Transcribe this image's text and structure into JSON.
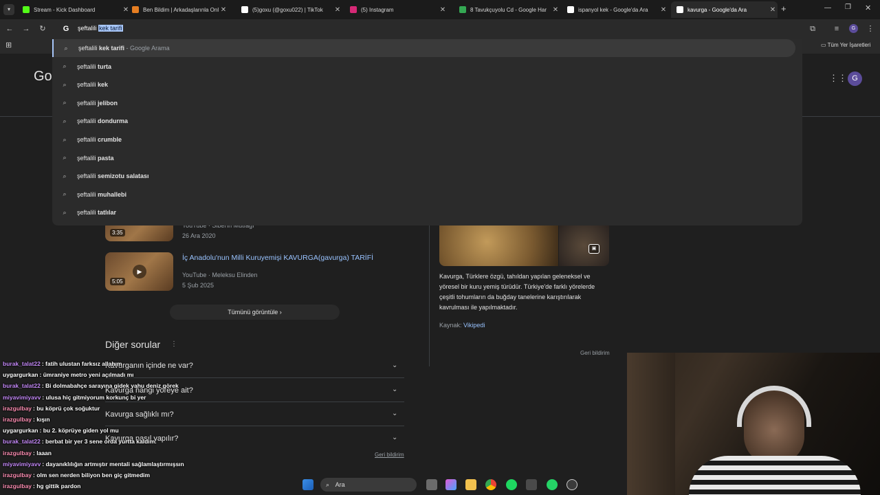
{
  "tabs": [
    {
      "title": "Stream - Kick Dashboard",
      "color": "#53fc18",
      "active": false
    },
    {
      "title": "Ben Bildim | Arkadaşlarınla Onl",
      "color": "#e67e22",
      "active": false
    },
    {
      "title": "(5)goxu (@goxu022) | TikTok",
      "color": "#ffffff",
      "active": false
    },
    {
      "title": "(5) Instagram",
      "color": "#d62976",
      "active": false
    },
    {
      "title": "8 Tavukçuyolu Cd - Google Har",
      "color": "#34a853",
      "active": false
    },
    {
      "title": "ispanyol kek - Google'da Ara",
      "color": "#ffffff",
      "active": false
    },
    {
      "title": "kavurga - Google'da Ara",
      "color": "#ffffff",
      "active": true
    }
  ],
  "omnibox": {
    "typed": "şeftalili ",
    "selected": "kek tarifi"
  },
  "bookmarks": {
    "all_label": "Tüm Yer İşaretleri"
  },
  "suggestions": [
    {
      "prefix": "şeftalili ",
      "bold": "kek tarifi",
      "suffix": " - Google Arama"
    },
    {
      "prefix": "şeftalili ",
      "bold": "turta",
      "suffix": ""
    },
    {
      "prefix": "şeftalili ",
      "bold": "kek",
      "suffix": ""
    },
    {
      "prefix": "şeftalili ",
      "bold": "jelibon",
      "suffix": ""
    },
    {
      "prefix": "şeftalili ",
      "bold": "dondurma",
      "suffix": ""
    },
    {
      "prefix": "şeftalili ",
      "bold": "crumble",
      "suffix": ""
    },
    {
      "prefix": "şeftalili ",
      "bold": "pasta",
      "suffix": ""
    },
    {
      "prefix": "şeftalili ",
      "bold": "semizotu salatası",
      "suffix": ""
    },
    {
      "prefix": "şeftalili ",
      "bold": "muhallebi",
      "suffix": ""
    },
    {
      "prefix": "şeftalili ",
      "bold": "tatlılar",
      "suffix": ""
    }
  ],
  "google": {
    "logo_partial": "Go",
    "avatar": "G"
  },
  "videos": [
    {
      "title": "",
      "channel": "YouTube · Sibel'in Mutfağı",
      "date": "26 Ara 2020",
      "duration": "3:35"
    },
    {
      "title": "İç Anadolu'nun Milli Kuruyemişi KAVURGA(gavurga) TARİFİ",
      "channel": "YouTube · Meleksu Elinden",
      "date": "5 Şub 2025",
      "duration": "5:05"
    }
  ],
  "show_all": "Tümünü görüntüle",
  "faq": {
    "title": "Diğer sorular",
    "items": [
      "Kavurganın içinde ne var?",
      "Kavurga hangi yöreye ait?",
      "Kavurga sağlıklı mı?",
      "Kavurga nasıl yapılır?"
    ],
    "feedback": "Geri bildirim"
  },
  "knowledge": {
    "description": "Kavurga, Türklere özgü, tahıldan yapılan geleneksel ve yöresel bir kuru yemiş türüdür. Türkiye'de farklı yörelerde çeşitli tohumların da buğday tanelerine karıştırılarak kavrulması ile yapılmaktadır.",
    "source_label": "Kaynak:",
    "source_link": "Vikipedi",
    "feedback": "Geri bildirim"
  },
  "chat": [
    {
      "user": "burak_talat22",
      "color": "#c58af9",
      "msg": ": fatih ulustan farksız allahım"
    },
    {
      "user": "uygargurkan",
      "color": "#ffffff",
      "msg": ": ümraniye metro yeni açılmadı mı"
    },
    {
      "user": "burak_talat22",
      "color": "#c58af9",
      "msg": ": Bi dolmabahçe sarayına gidek yahu deniz görek"
    },
    {
      "user": "miyavimiyavv",
      "color": "#c58af9",
      "msg": ": ulusa hiç gitmiyorum korkunç bi yer"
    },
    {
      "user": "irazgulbay",
      "color": "#ff8fb4",
      "msg": ": bu köprü çok soğuktur"
    },
    {
      "user": "irazgulbay",
      "color": "#ff8fb4",
      "msg": ": kışın"
    },
    {
      "user": "uygargurkan",
      "color": "#ffffff",
      "msg": ": bu 2. köprüye giden yol mu"
    },
    {
      "user": "burak_talat22",
      "color": "#c58af9",
      "msg": ": berbat bir yer 3 sene orda yurtta kaldım."
    },
    {
      "user": "irazgulbay",
      "color": "#ff8fb4",
      "msg": ": laaan"
    },
    {
      "user": "miyavimiyavv",
      "color": "#c58af9",
      "msg": ": dayanıklılığın artmıştır mentali sağlamlaştırmışsın"
    },
    {
      "user": "irazgulbay",
      "color": "#ff8fb4",
      "msg": ": olm sen nerden biliyon ben giç gitmedim"
    },
    {
      "user": "irazgulbay",
      "color": "#ff8fb4",
      "msg": ": hg gittik pardon"
    }
  ],
  "taskbar": {
    "search_label": "Ara"
  }
}
